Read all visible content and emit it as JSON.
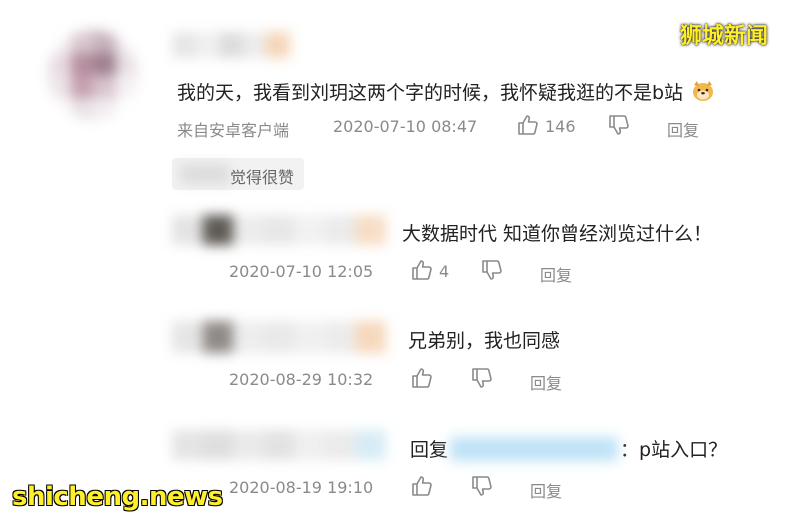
{
  "watermark": {
    "top": "狮城新闻",
    "bottom": "shicheng.news"
  },
  "main_comment": {
    "text": "我的天，我看到刘玥这两个字的时候，我怀疑我逛的不是b站",
    "source": "来自安卓客户端",
    "timestamp": "2020-07-10 08:47",
    "likes": "146",
    "reply_label": "回复",
    "emoji": "doge-emoji"
  },
  "like_summary": {
    "suffix": "觉得很赞"
  },
  "replies": [
    {
      "text": "大数据时代 知道你曾经浏览过什么！",
      "timestamp": "2020-07-10 12:05",
      "likes": "4",
      "reply_label": "回复"
    },
    {
      "text": "兄弟别，我也同感",
      "timestamp": "2020-08-29 10:32",
      "likes": "",
      "reply_label": "回复"
    },
    {
      "text_prefix": "回复",
      "text_suffix": "：p站入口？",
      "timestamp": "2020-08-19 19:10",
      "likes": "",
      "reply_label": "回复"
    }
  ],
  "icons": {
    "like": "thumbs-up-icon",
    "dislike": "thumbs-down-icon"
  }
}
